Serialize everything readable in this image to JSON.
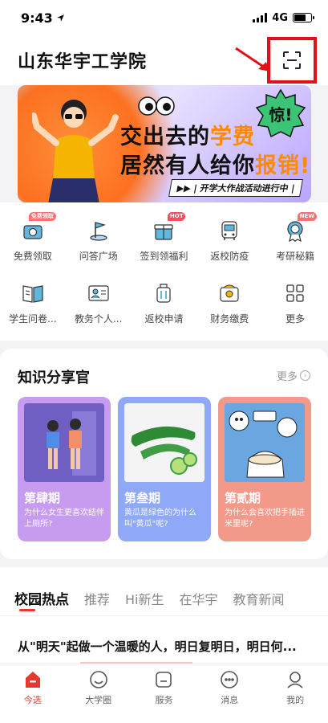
{
  "status_bar": {
    "time": "9:43",
    "network": "4G"
  },
  "header": {
    "title": "山东华宇工学院"
  },
  "banner": {
    "line1_prefix": "交出去的",
    "line1_accent": "学费",
    "line2_prefix": "居然有人给你",
    "line2_accent": "报销!",
    "tag": "▶▶ | 开学大作战活动进行中 |",
    "stamp": "惊!"
  },
  "quick_grid": {
    "row1": [
      {
        "label": "免费领取",
        "icon": "gift-camera-icon",
        "badge": "免费领取"
      },
      {
        "label": "问答广场",
        "icon": "flag-icon"
      },
      {
        "label": "签到领福利",
        "icon": "gift-box-icon",
        "badge": "HOT"
      },
      {
        "label": "返校防疫",
        "icon": "bus-icon"
      },
      {
        "label": "考研秘籍",
        "icon": "award-icon",
        "badge": "NEW"
      }
    ],
    "row2": [
      {
        "label": "学生问卷...",
        "icon": "book-icon"
      },
      {
        "label": "教务个人...",
        "icon": "id-card-icon"
      },
      {
        "label": "返校申请",
        "icon": "luggage-icon"
      },
      {
        "label": "财务缴费",
        "icon": "wallet-icon"
      },
      {
        "label": "更多",
        "icon": "grid-more-icon"
      }
    ]
  },
  "knowledge": {
    "title": "知识分享官",
    "more": "更多",
    "cards": [
      {
        "title": "第肆期",
        "desc": "为什么女生更喜欢结伴上厕所?",
        "color": "#c79cf0"
      },
      {
        "title": "第叁期",
        "desc": "黄瓜是绿色的为什么叫\"黄瓜\"呢?",
        "color": "#8fa8f7"
      },
      {
        "title": "第贰期",
        "desc": "为什么会喜欢把手插进米里呢?",
        "color": "#f3998a"
      }
    ]
  },
  "news_tabs": {
    "tabs": [
      "校园热点",
      "推荐",
      "Hi新生",
      "在华宇",
      "教育新闻"
    ],
    "headline": "从\"明天\"起做一个温暖的人，明日复明日，明日何..."
  },
  "bottom_nav": [
    {
      "label": "今选",
      "icon": "home-icon",
      "active": true
    },
    {
      "label": "大学圈",
      "icon": "smile-icon"
    },
    {
      "label": "服务",
      "icon": "service-icon"
    },
    {
      "label": "消息",
      "icon": "message-icon"
    },
    {
      "label": "我的",
      "icon": "profile-icon"
    }
  ],
  "colors": {
    "accent": "#e8382e",
    "highlight_box": "#e3101a"
  }
}
